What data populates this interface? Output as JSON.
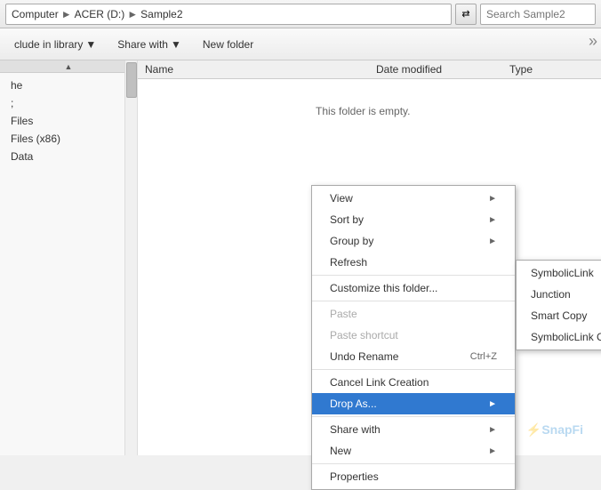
{
  "addressBar": {
    "path": [
      "Computer",
      "ACER (D:)",
      "Sample2"
    ],
    "refreshTitle": "↻",
    "searchPlaceholder": "Search Sample2"
  },
  "toolbar": {
    "includeLibrary": "clude in library",
    "includeLibraryArrow": "▼",
    "shareWith": "Share with",
    "shareWithArrow": "▼",
    "newFolder": "New folder"
  },
  "columns": {
    "name": "Name",
    "dateModified": "Date modified",
    "type": "Type"
  },
  "emptyMessage": "This folder is empty.",
  "sidebar": {
    "items": [
      {
        "label": "he"
      },
      {
        "label": ";"
      },
      {
        "label": "Files"
      },
      {
        "label": "Files (x86)"
      },
      {
        "label": "Data"
      }
    ]
  },
  "contextMenu": {
    "items": [
      {
        "id": "view",
        "label": "View",
        "hasArrow": true,
        "disabled": false
      },
      {
        "id": "sort-by",
        "label": "Sort by",
        "hasArrow": true,
        "disabled": false
      },
      {
        "id": "group-by",
        "label": "Group by",
        "hasArrow": true,
        "disabled": false
      },
      {
        "id": "refresh",
        "label": "Refresh",
        "hasArrow": false,
        "disabled": false
      },
      {
        "id": "sep1",
        "type": "separator"
      },
      {
        "id": "customize",
        "label": "Customize this folder...",
        "hasArrow": false,
        "disabled": false
      },
      {
        "id": "sep2",
        "type": "separator"
      },
      {
        "id": "paste",
        "label": "Paste",
        "hasArrow": false,
        "disabled": true
      },
      {
        "id": "paste-shortcut",
        "label": "Paste shortcut",
        "hasArrow": false,
        "disabled": true
      },
      {
        "id": "undo-rename",
        "label": "Undo Rename",
        "shortcut": "Ctrl+Z",
        "hasArrow": false,
        "disabled": false
      },
      {
        "id": "sep3",
        "type": "separator"
      },
      {
        "id": "cancel-link",
        "label": "Cancel Link Creation",
        "hasArrow": false,
        "disabled": false
      },
      {
        "id": "drop-as",
        "label": "Drop As...",
        "hasArrow": true,
        "disabled": false,
        "active": true
      },
      {
        "id": "sep4",
        "type": "separator"
      },
      {
        "id": "share-with",
        "label": "Share with",
        "hasArrow": true,
        "disabled": false
      },
      {
        "id": "new",
        "label": "New",
        "hasArrow": true,
        "disabled": false
      },
      {
        "id": "sep5",
        "type": "separator"
      },
      {
        "id": "properties",
        "label": "Properties",
        "hasArrow": false,
        "disabled": false
      }
    ]
  },
  "submenu": {
    "items": [
      {
        "label": "SymbolicLink"
      },
      {
        "label": "Junction"
      },
      {
        "label": "Smart Copy"
      },
      {
        "label": "SymbolicLink Clone"
      }
    ]
  },
  "watermark": "SnapFi"
}
